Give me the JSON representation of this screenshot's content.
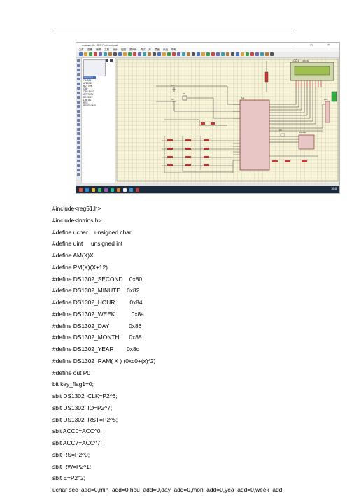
{
  "screenshot": {
    "window_title": "mainwin8 - ISIS Professional",
    "menu": [
      "文件",
      "查看",
      "编辑",
      "工具",
      "设计",
      "绘图",
      "源代码",
      "调试",
      "库",
      "模板",
      "系统",
      "帮助"
    ],
    "devices": [
      "74HC573",
      "74LS08",
      "AT89C51",
      "BUTTON",
      "CAP",
      "CAP-ELEC",
      "CRYSTAL",
      "DS1302",
      "LM016L",
      "RES",
      "RESPACK-8"
    ],
    "canvas_labels": {
      "lcd": "LCD1",
      "lcd_model": "LM016L",
      "rp": "RP1",
      "u1": "U1",
      "u2": "DS1302",
      "c1": "C1",
      "c2": "C2",
      "x1": "X1",
      "x2": "X2"
    },
    "taskbar_time": "16:48"
  },
  "code_lines": [
    "#include<reg51.h>",
    "#include<intrins.h>",
    "#define uchar    unsigned char",
    "#define uint     unsigned int",
    "#define AM(X)X",
    "#define PM(X)(X+12)",
    "#define DS1302_SECOND    0x80",
    "#define DS1302_MINUTE    0x82",
    "#define DS1302_HOUR         0x84",
    "#define DS1302_WEEK          0x8a",
    "#define DS1302_DAY            0x86",
    "#define DS1302_MONTH      0x88",
    "#define DS1302_YEAR        0x8c",
    "#define DS1302_RAM( X ) (0xc0+(x)*2)",
    "#define out P0",
    "bit key_flag1=0;",
    "sbit DS1302_CLK=P2^6;",
    "sbit DS1302_IO=P2^7;",
    "sbit DS1302_RST=P2^5;",
    "sbit ACC0=ACC^0;",
    "sbit ACC7=ACC^7;",
    "sbit RS=P2^0;",
    "sbit RW=P2^1;",
    "sbit E=P2^2;",
    "uchar sec_add=0,min_add=0,hou_add=0,day_add=0,mon_add=0,yea_add=0,week_add;"
  ]
}
